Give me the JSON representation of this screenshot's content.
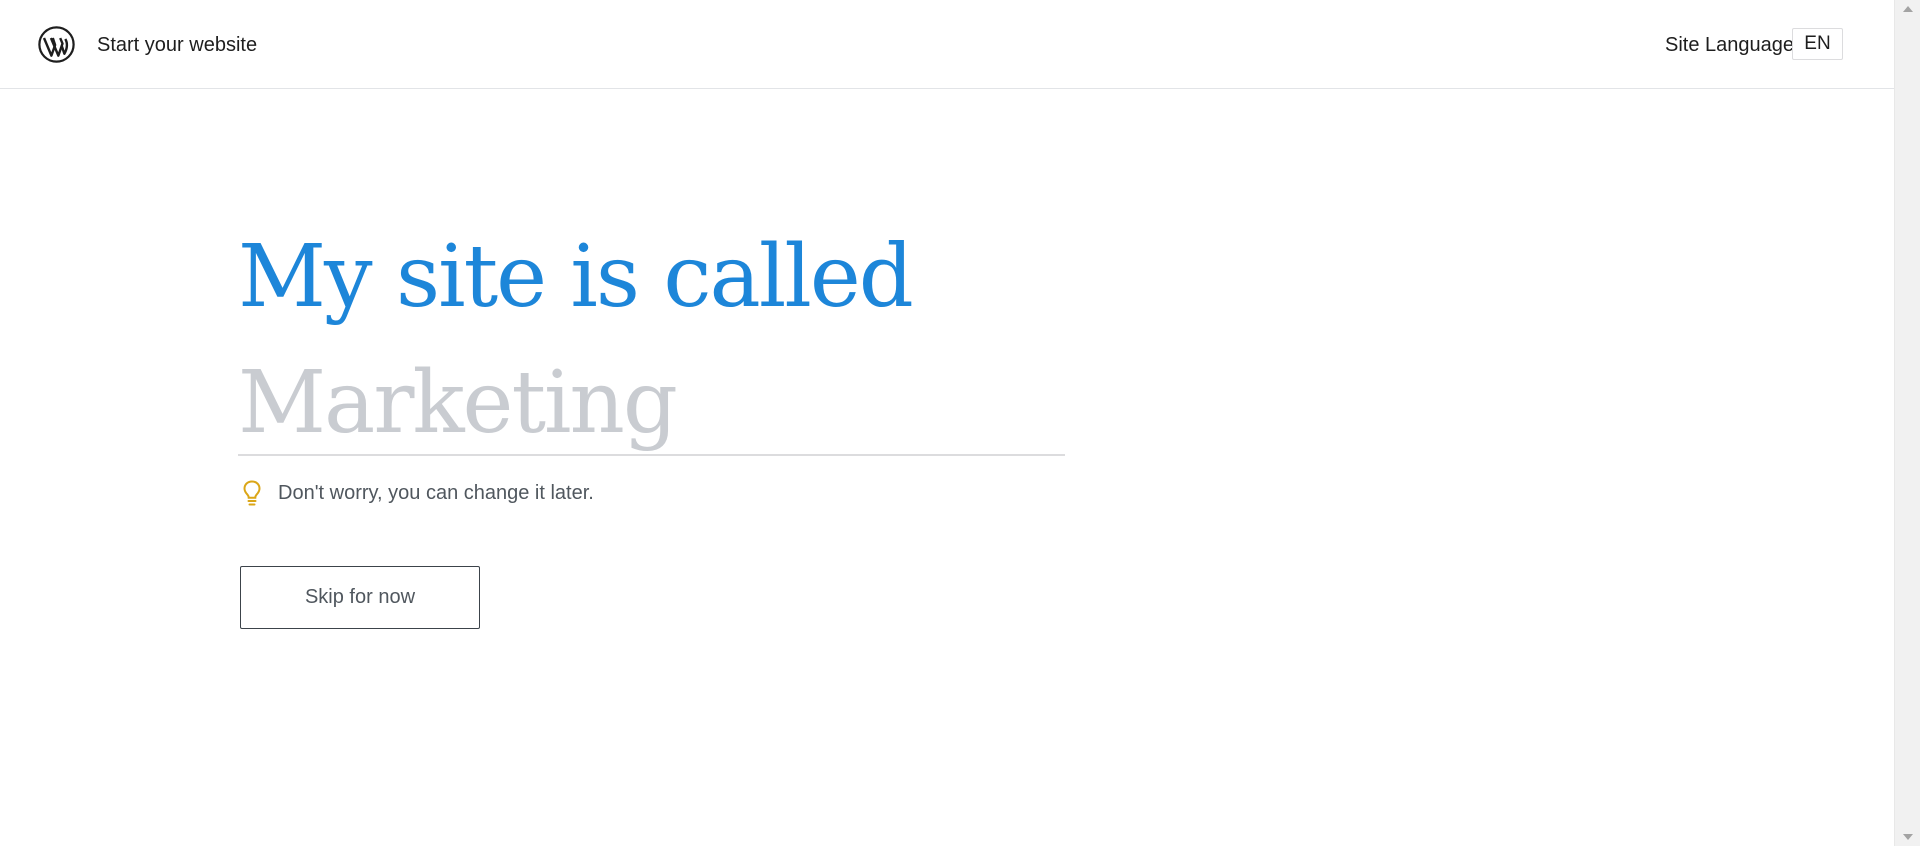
{
  "header": {
    "logo_icon": "wordpress-logo-icon",
    "title": "Start your website",
    "language_label": "Site Language",
    "language_value": "EN"
  },
  "main": {
    "headline": "My site is called",
    "site_name_input": {
      "value": "",
      "placeholder": "Marketing"
    },
    "hint_icon": "lightbulb-icon",
    "hint_text": "Don't worry, you can change it later.",
    "skip_button_label": "Skip for now"
  },
  "colors": {
    "accent": "#1d86d9",
    "placeholder": "#c9ccd1",
    "hint_icon": "#dba617",
    "text": "#1e1e1e"
  }
}
